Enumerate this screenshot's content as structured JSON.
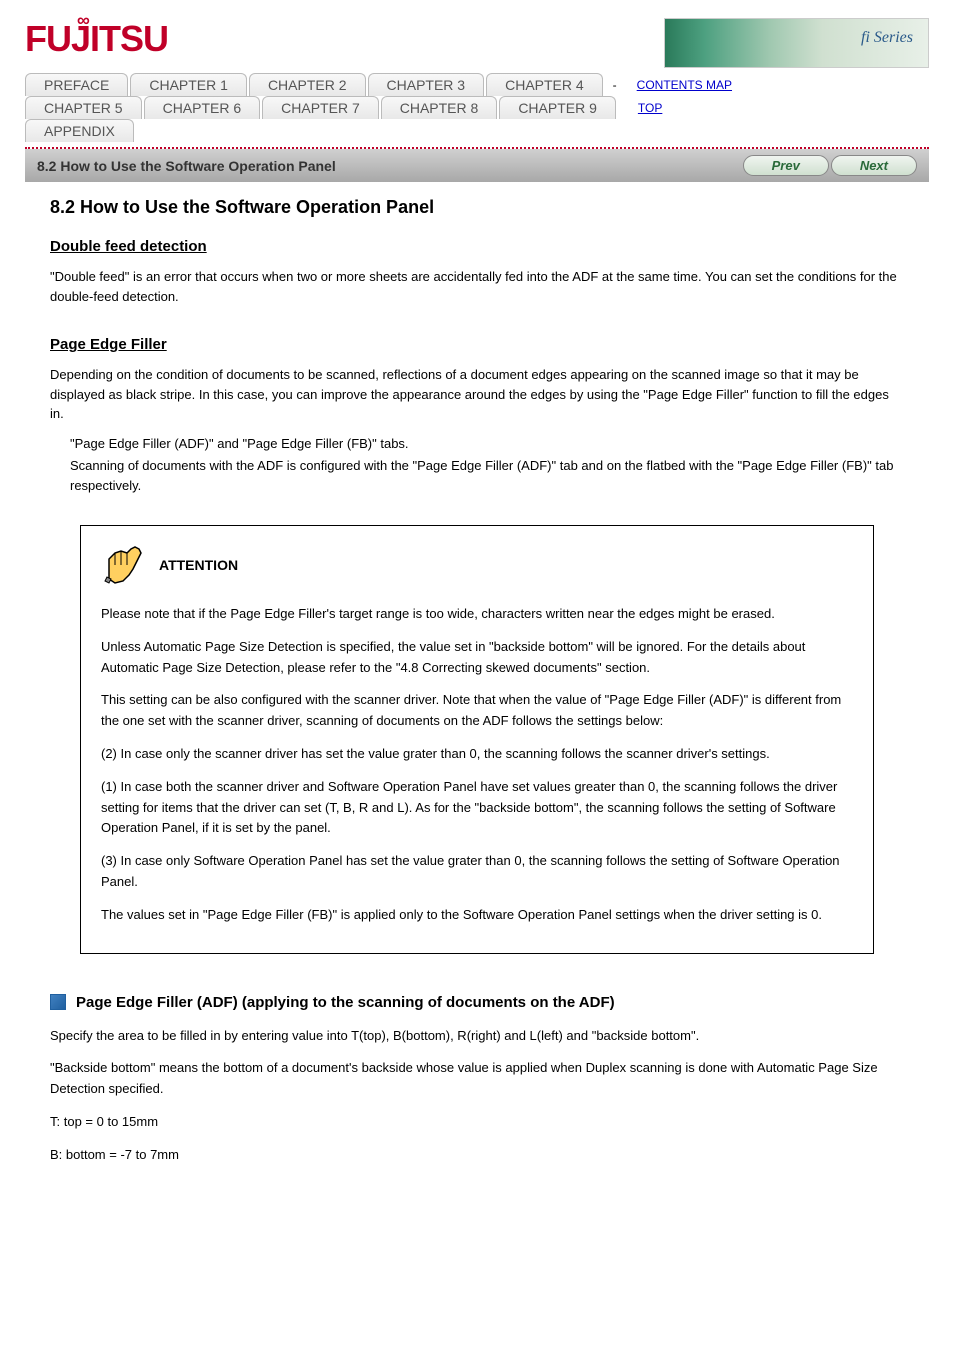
{
  "header": {
    "logo_text": "FUJITSU",
    "banner_text": "fi Series"
  },
  "nav": {
    "tabs_row1": [
      "PREFACE",
      "CHAPTER 1",
      "CHAPTER 2",
      "CHAPTER 3",
      "CHAPTER 4"
    ],
    "tabs_row2": [
      "CHAPTER 5",
      "CHAPTER 6",
      "CHAPTER 7",
      "CHAPTER 8",
      "CHAPTER 9"
    ],
    "tabs_row3": [
      "APPENDIX"
    ],
    "link1": "CONTENTS MAP",
    "link2": "TOP",
    "dash": "-"
  },
  "titlebar": {
    "title": "8.2 How to Use the Software Operation Panel",
    "prev": "Prev",
    "next": "Next"
  },
  "content": {
    "main_title": "8.2 How to Use the Software Operation Panel",
    "sub1_title": "Double feed detection",
    "sub1_text": "\"Double feed\" is an error that occurs when two or more sheets are accidentally fed into the ADF at the same time. You can set the conditions for the double-feed detection.",
    "sub2_title": "Page Edge Filler",
    "sub2_text": "Depending on the condition of documents to be scanned, reflections of a document edges appearing on the scanned image so that it may be displayed as black stripe. In this case, you can improve the appearance around the edges by using the \"Page Edge Filler\" function to fill the edges in.",
    "sub2_items": [
      "\"Page Edge Filler (ADF)\" and \"Page Edge Filler (FB)\" tabs.",
      "Scanning of documents with the ADF is configured with the \"Page Edge Filler (ADF)\" tab and on the flatbed with the \"Page Edge Filler (FB)\" tab respectively."
    ],
    "attention_label": "ATTENTION",
    "attention_paragraphs": [
      "Please note that if the Page Edge Filler's target range is too wide, characters written near the edges might be erased.",
      "Unless Automatic Page Size Detection is specified, the value set in \"backside bottom\" will be ignored. For the details about Automatic Page Size Detection, please refer to the \"4.8 Correcting skewed documents\" section.",
      "This setting can be also configured with the scanner driver. Note that when the value of \"Page Edge Filler (ADF)\" is different from the one set with the scanner driver, scanning of documents on the ADF follows the settings below:",
      "(2) In case only the scanner driver has set the value grater than 0, the scanning follows the scanner driver's settings.",
      "(1) In case both the scanner driver and Software Operation Panel have set values greater than 0, the scanning follows the driver setting for items that the driver can set (T, B, R and L). As for the \"backside bottom\", the scanning follows the setting of Software Operation Panel, if it is set by the panel.",
      "(3) In case only Software Operation Panel has set the value grater than 0, the scanning follows the setting of Software Operation Panel.",
      "The values set in \"Page Edge Filler (FB)\" is applied only to the Software Operation Panel settings when the driver setting is 0."
    ],
    "bottom_title": "Page Edge Filler (ADF) (applying to the scanning of documents on the ADF)",
    "bottom_p1": "Specify the area to be filled in by entering value into T(top), B(bottom), R(right) and L(left) and \"backside bottom\".",
    "bottom_p2": "\"Backside bottom\" means the bottom of a document's backside whose value is applied when Duplex scanning is done with Automatic Page Size Detection specified.",
    "bottom_t": "T: top = 0 to 15mm",
    "bottom_b": "B: bottom = -7 to 7mm"
  }
}
